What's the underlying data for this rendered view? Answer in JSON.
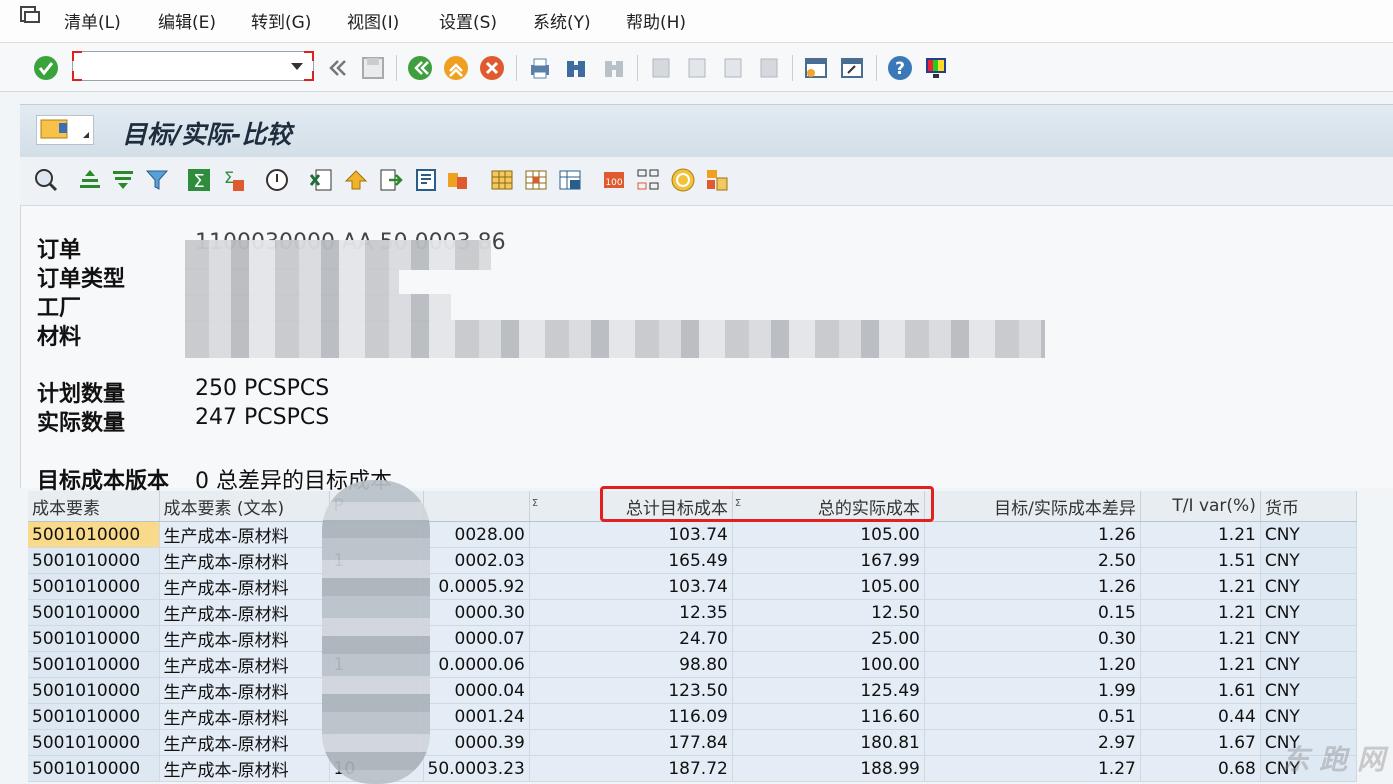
{
  "menu": [
    "清单(L)",
    "编辑(E)",
    "转到(G)",
    "视图(I)",
    "设置(S)",
    "系统(Y)",
    "帮助(H)"
  ],
  "command_field": {
    "value": ""
  },
  "title": "目标/实际-比较",
  "header": {
    "order_label": "订单",
    "order_value": "1100030000 AA 50 0003 86",
    "order_type_label": "订单类型",
    "plant_label": "工厂",
    "material_label": "材料",
    "planned_qty_label": "计划数量",
    "planned_qty_value": "250 PCSPCS",
    "actual_qty_label": "实际数量",
    "actual_qty_value": "247 PCSPCS",
    "version_label": "目标成本版本",
    "version_value": "0 总差异的目标成本"
  },
  "grid": {
    "columns": [
      "成本要素",
      "成本要素 (文本)",
      "P",
      "",
      "总计目标成本",
      "总的实际成本",
      "目标/实际成本差异",
      "T/I var(%)",
      "货币"
    ],
    "rows": [
      [
        "5001010000",
        "生产成本-原材料",
        "",
        "0028.00",
        "103.74",
        "105.00",
        "1.26",
        "1.21",
        "CNY"
      ],
      [
        "5001010000",
        "生产成本-原材料",
        "1",
        "0002.03",
        "165.49",
        "167.99",
        "2.50",
        "1.51",
        "CNY"
      ],
      [
        "5001010000",
        "生产成本-原材料",
        "",
        "0.0005.92",
        "103.74",
        "105.00",
        "1.26",
        "1.21",
        "CNY"
      ],
      [
        "5001010000",
        "生产成本-原材料",
        "",
        "0000.30",
        "12.35",
        "12.50",
        "0.15",
        "1.21",
        "CNY"
      ],
      [
        "5001010000",
        "生产成本-原材料",
        "",
        "0000.07",
        "24.70",
        "25.00",
        "0.30",
        "1.21",
        "CNY"
      ],
      [
        "5001010000",
        "生产成本-原材料",
        "1",
        "0.0000.06",
        "98.80",
        "100.00",
        "1.20",
        "1.21",
        "CNY"
      ],
      [
        "5001010000",
        "生产成本-原材料",
        "",
        "0000.04",
        "123.50",
        "125.49",
        "1.99",
        "1.61",
        "CNY"
      ],
      [
        "5001010000",
        "生产成本-原材料",
        "",
        "0001.24",
        "116.09",
        "116.60",
        "0.51",
        "0.44",
        "CNY"
      ],
      [
        "5001010000",
        "生产成本-原材料",
        "",
        "0000.39",
        "177.84",
        "180.81",
        "2.97",
        "1.67",
        "CNY"
      ],
      [
        "5001010000",
        "生产成本-原材料",
        "10",
        "50.0003.23",
        "187.72",
        "188.99",
        "1.27",
        "0.68",
        "CNY"
      ]
    ]
  },
  "watermark": "东 跑 网",
  "colors": {
    "accent_red": "#e32020",
    "selected_cell": "#f9d98a",
    "title_bg": "#dbe4ed"
  }
}
